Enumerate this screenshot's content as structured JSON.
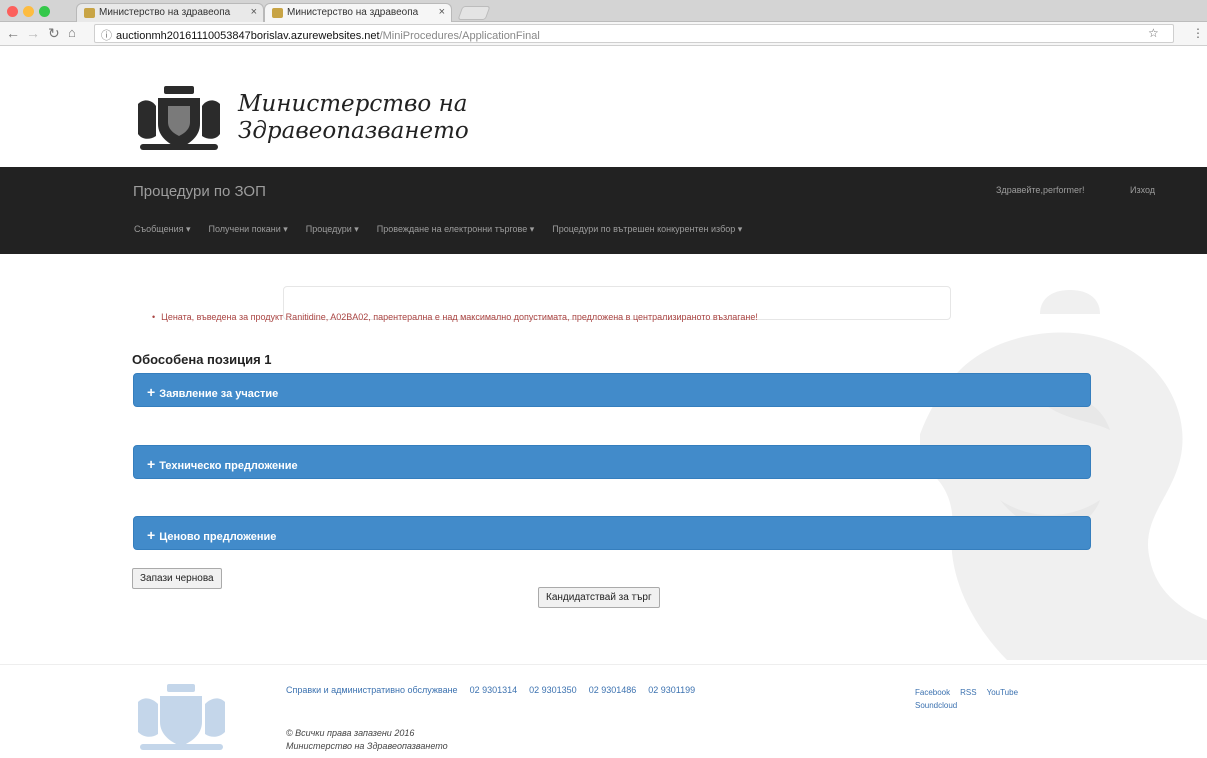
{
  "browser": {
    "tabs": [
      {
        "title": "Министерство на здравеопа",
        "active": false
      },
      {
        "title": "Министерство на здравеопа",
        "active": true
      }
    ],
    "url_host": "auctionmh20161110053847borislav.azurewebsites.net",
    "url_path": "/MiniProcedures/ApplicationFinal"
  },
  "header": {
    "title_line1": "Министерство на",
    "title_line2": "Здравеопазването"
  },
  "nav": {
    "brand": "Процедури по ЗОП",
    "greeting": "Здравейте,performer!",
    "logout": "Изход",
    "menu": [
      "Съобщения ▾",
      "Получени покани ▾",
      "Процедури ▾",
      "Провеждане на електронни търгове ▾",
      "Процедури по вътрешен конкурентен избор ▾"
    ]
  },
  "main": {
    "error": "Цената, въведена за продукт Ranitidine, A02BA02, парентерална е над максимално допустимата, предложена в централизираното възлагане!",
    "group_title": "Обособена позиция 1",
    "panels": [
      {
        "label": "Заявление за участие"
      },
      {
        "label": "Техническо предложение"
      },
      {
        "label": "Ценово предложение"
      }
    ],
    "save_draft": "Запази чернова",
    "submit": "Кандидатствай за търг"
  },
  "footer": {
    "links": [
      "Справки и административно обслужване",
      "02 9301314",
      "02 9301350",
      "02 9301486",
      "02 9301199"
    ],
    "social": [
      "Facebook",
      "RSS",
      "YouTube",
      "Soundcloud"
    ],
    "copyright": "© Всички права запазени 2016",
    "org": "Министерство на Здравеопазването"
  },
  "colors": {
    "nav_bg": "#222222",
    "panel_blue": "#428bca",
    "error_red": "#a94442",
    "link_blue": "#3c72b0"
  },
  "icons": {
    "panel_toggle": "plus-icon",
    "crest": "coat-of-arms-icon",
    "watermark": "lion-watermark-icon"
  }
}
